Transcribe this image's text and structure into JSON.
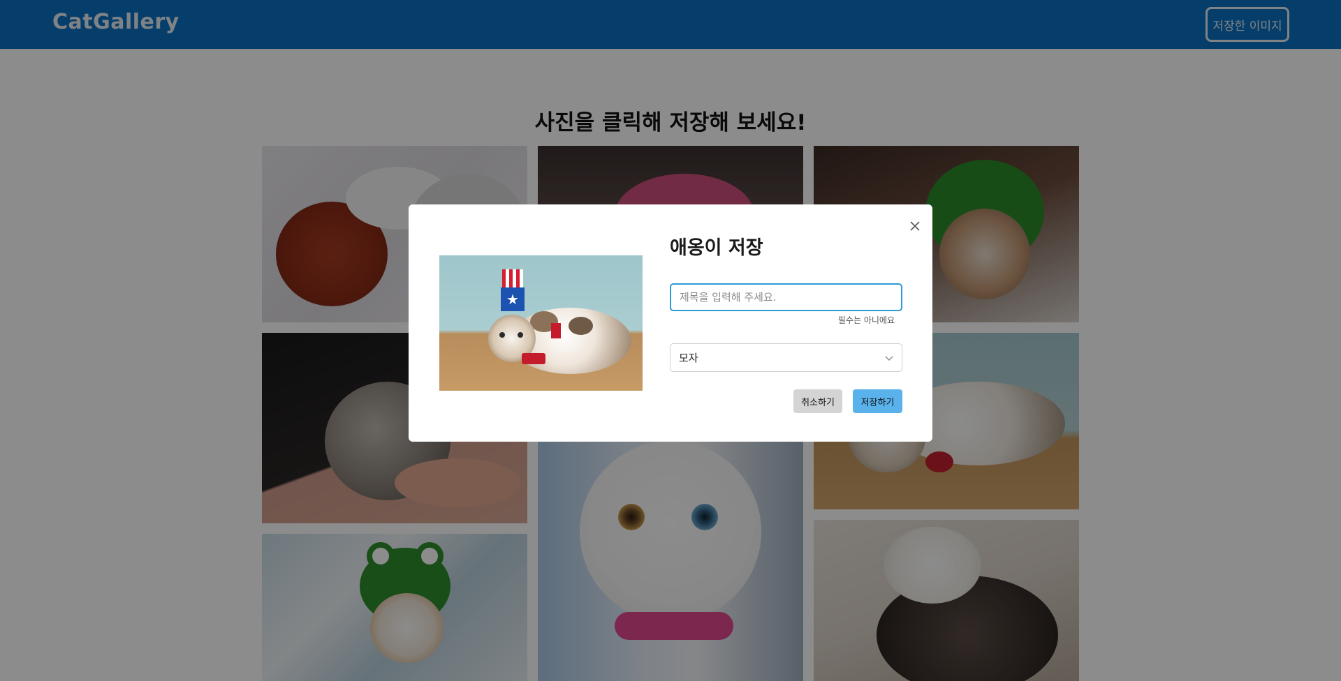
{
  "header": {
    "logo": "CatGallery",
    "saved_images_button": "저장한 이미지"
  },
  "main": {
    "title": "사진을 클릭해 저장해 보세요!"
  },
  "modal": {
    "title": "애옹이 저장",
    "title_input": {
      "value": "",
      "placeholder": "제목을 입력해 주세요."
    },
    "hint": "필수는 아니에요",
    "category_select": {
      "selected": "모자"
    },
    "cancel_label": "취소하기",
    "save_label": "저장하기"
  },
  "icons": {
    "close": "close-icon",
    "dropdown": "chevron-down-icon"
  },
  "colors": {
    "header": "#0b72c4",
    "save_button": "#5ab2ec",
    "input_focus": "#2a9ad8"
  }
}
